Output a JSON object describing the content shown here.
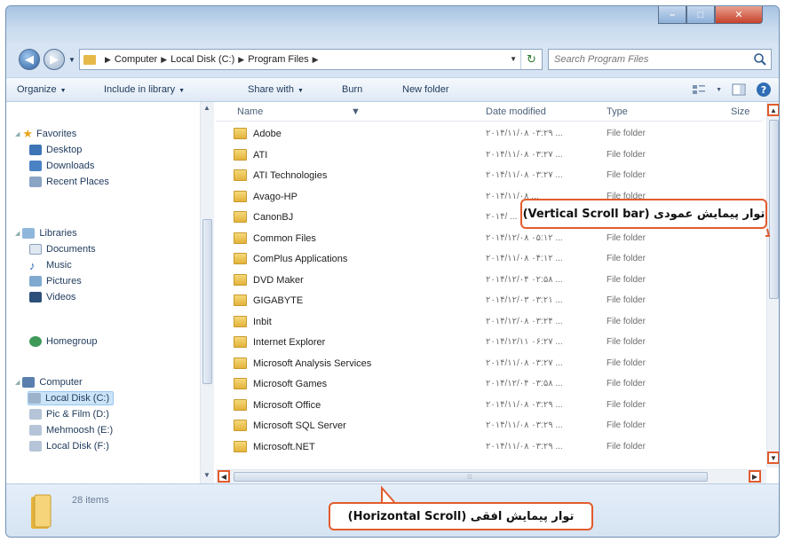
{
  "window": {
    "title": "",
    "accent": "#e25b2c",
    "folder_color": "#e4b33c"
  },
  "nav": {
    "back_icon": "arrow-left-icon",
    "forward_icon": "arrow-right-icon",
    "breadcrumbs": [
      "Computer",
      "Local Disk (C:)",
      "Program Files"
    ],
    "search_placeholder": "Search Program Files"
  },
  "toolbar": {
    "organize": "Organize",
    "include_in_library": "Include in library",
    "share_with": "Share with",
    "burn": "Burn",
    "new_folder": "New folder"
  },
  "sidebar": {
    "favorites": {
      "label": "Favorites",
      "items": [
        "Desktop",
        "Downloads",
        "Recent Places"
      ]
    },
    "libraries": {
      "label": "Libraries",
      "items": [
        "Documents",
        "Music",
        "Pictures",
        "Videos"
      ]
    },
    "homegroup": {
      "label": "Homegroup"
    },
    "computer": {
      "label": "Computer",
      "items": [
        "Local Disk (C:)",
        "Pic & Film (D:)",
        "Mehmoosh (E:)",
        "Local Disk (F:)"
      ]
    }
  },
  "columns": {
    "name": "Name",
    "date_modified": "Date modified",
    "type": "Type",
    "size": "Size"
  },
  "files": [
    {
      "name": "Adobe",
      "date": "۲۰۱۴/۱۱/۰۸ ۰۳:۲۹ ...",
      "type": "File folder"
    },
    {
      "name": "ATI",
      "date": "۲۰۱۴/۱۱/۰۸ ۰۳:۲۷ ...",
      "type": "File folder"
    },
    {
      "name": "ATI Technologies",
      "date": "۲۰۱۴/۱۱/۰۸ ۰۳:۲۷ ...",
      "type": "File folder"
    },
    {
      "name": "Avago-HP",
      "date": "۲۰۱۴/۱۱/۰۸ ...",
      "type": "File folder"
    },
    {
      "name": "CanonBJ",
      "date": "۲۰۱۴/ ...",
      "type": "File folder"
    },
    {
      "name": "Common Files",
      "date": "۲۰۱۴/۱۲/۰۸ ۰۵:۱۲ ...",
      "type": "File folder"
    },
    {
      "name": "ComPlus Applications",
      "date": "۲۰۱۴/۱۱/۰۸ ۰۴:۱۲ ...",
      "type": "File folder"
    },
    {
      "name": "DVD Maker",
      "date": "۲۰۱۴/۱۲/۰۴ ۰۲:۵۸ ...",
      "type": "File folder"
    },
    {
      "name": "GIGABYTE",
      "date": "۲۰۱۴/۱۲/۰۳ ۰۳:۲۱ ...",
      "type": "File folder"
    },
    {
      "name": "Inbit",
      "date": "۲۰۱۴/۱۲/۰۸ ۰۳:۲۴ ...",
      "type": "File folder"
    },
    {
      "name": "Internet Explorer",
      "date": "۲۰۱۴/۱۲/۱۱ ۰۶:۲۷ ...",
      "type": "File folder"
    },
    {
      "name": "Microsoft Analysis Services",
      "date": "۲۰۱۴/۱۱/۰۸ ۰۳:۲۷ ...",
      "type": "File folder"
    },
    {
      "name": "Microsoft Games",
      "date": "۲۰۱۴/۱۲/۰۴ ۰۳:۵۸ ...",
      "type": "File folder"
    },
    {
      "name": "Microsoft Office",
      "date": "۲۰۱۴/۱۱/۰۸ ۰۳:۲۹ ...",
      "type": "File folder"
    },
    {
      "name": "Microsoft SQL Server",
      "date": "۲۰۱۴/۱۱/۰۸ ۰۳:۲۹ ...",
      "type": "File folder"
    },
    {
      "name": "Microsoft.NET",
      "date": "۲۰۱۴/۱۱/۰۸ ۰۳:۲۹ ...",
      "type": "File folder"
    }
  ],
  "status": {
    "items_count": "28 items"
  },
  "callouts": {
    "vertical": "توار پیمایش عمودی (Vertical Scroll bar)",
    "horizontal": "توار پیمایش افقی (Horizontal Scroll)"
  }
}
